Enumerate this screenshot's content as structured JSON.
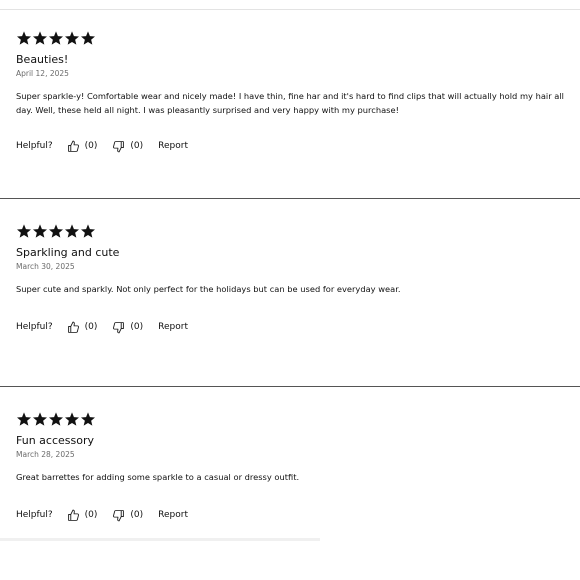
{
  "labels": {
    "helpful": "Helpful?",
    "report": "Report"
  },
  "reviews": [
    {
      "rating": 5,
      "title": "Beauties!",
      "date": "April 12, 2025",
      "body": "Super sparkle-y! Comfortable wear and nicely made! I have thin, fine har and it's hard to find clips that will actually hold my hair all day. Well, these held all night. I was pleasantly surprised and very happy with my purchase!",
      "helpful_up": "(0)",
      "helpful_down": "(0)"
    },
    {
      "rating": 5,
      "title": "Sparkling and cute",
      "date": "March 30, 2025",
      "body": "Super cute and sparkly. Not only perfect for the holidays but can be used for everyday wear.",
      "helpful_up": "(0)",
      "helpful_down": "(0)"
    },
    {
      "rating": 5,
      "title": "Fun accessory",
      "date": "March 28, 2025",
      "body": "Great barrettes for adding some sparkle to a casual or dressy outfit.",
      "helpful_up": "(0)",
      "helpful_down": "(0)"
    }
  ],
  "icons": {
    "star": "star-icon",
    "thumbs_up": "thumbs-up-icon",
    "thumbs_down": "thumbs-down-icon"
  },
  "colors": {
    "text": "#111111",
    "muted": "#6b6b6b",
    "divider": "#555555",
    "background": "#ffffff"
  }
}
